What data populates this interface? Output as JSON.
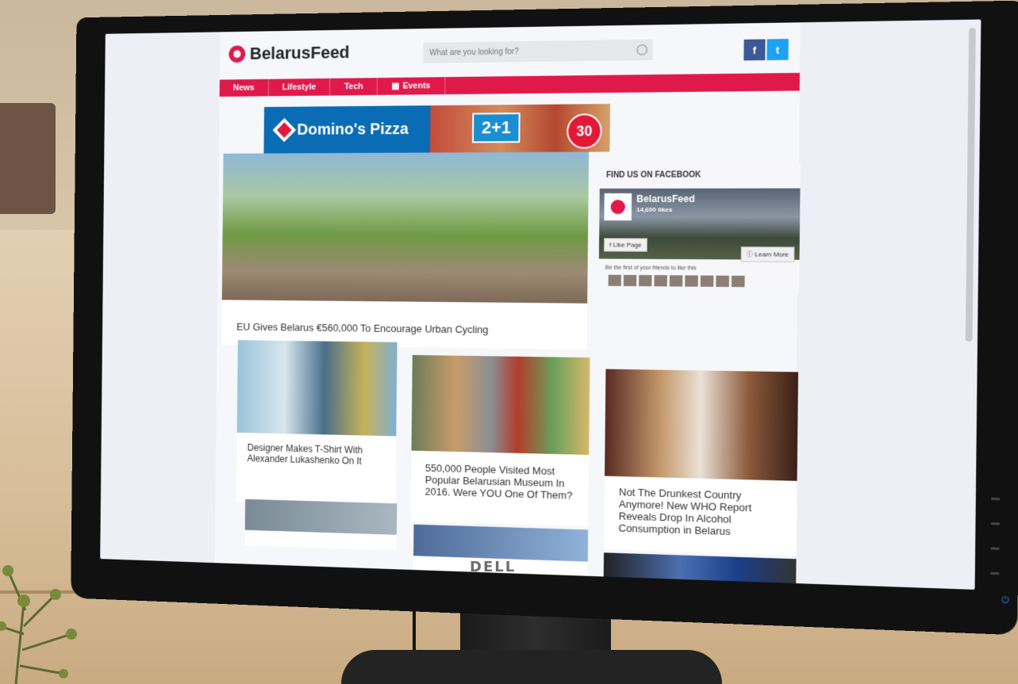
{
  "site": {
    "logo": "BelarusFeed",
    "search_placeholder": "What are you looking for?",
    "social": {
      "facebook": "f",
      "twitter": "t"
    },
    "nav": [
      "News",
      "Lifestyle",
      "Tech",
      "Events"
    ]
  },
  "ad": {
    "brand": "Domino's Pizza",
    "offer": "2+1",
    "badge": "30"
  },
  "hero": {
    "caption": "EU Gives Belarus €560,000 To Encourage Urban Cycling"
  },
  "facebook_widget": {
    "title": "FIND US ON FACEBOOK",
    "page_name": "BelarusFeed",
    "likes": "14,600 likes",
    "like_button": "Like Page",
    "learn_button": "Learn More",
    "friends_text": "Be the first of your friends to like this"
  },
  "articles": [
    {
      "caption": "Designer Makes T-Shirt With Alexander Lukashenko On It"
    },
    {
      "caption": "550,000 People Visited Most Popular Belarusian Museum In 2016. Were YOU One Of Them?"
    },
    {
      "caption": "Not The Drunkest Country Anymore! New WHO Report Reveals Drop In Alcohol Consumption in Belarus"
    }
  ],
  "monitor": {
    "brand": "DELL"
  }
}
